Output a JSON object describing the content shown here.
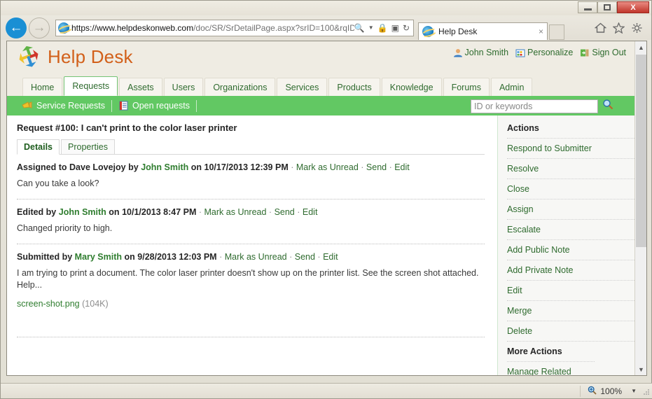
{
  "browser": {
    "window_controls": {
      "minimize": "minimize-icon",
      "restore": "restore-icon",
      "close": "X"
    },
    "nav": {
      "back": "back-icon",
      "forward": "forward-icon"
    },
    "address": {
      "protocol_host": "https://www.helpdeskonweb.com",
      "path": "/doc/SR/SrDetailPage.aspx?srID=100&rqID:",
      "full": "https://www.helpdeskonweb.com/doc/SR/SrDetailPage.aspx?srID=100&rqID:",
      "icons": [
        "search-icon",
        "chevron-down-icon",
        "lock-icon",
        "compatibility-view-icon",
        "refresh-icon"
      ]
    },
    "tab": {
      "title": "Help Desk",
      "close": "×"
    },
    "toolbar_icons": [
      "home-icon",
      "favorites-star-icon",
      "settings-gear-icon"
    ]
  },
  "site": {
    "title": "Help Desk",
    "logo": "pinwheel-arrows-logo",
    "account": {
      "user": "John Smith",
      "personalize": "Personalize",
      "sign_out": "Sign Out"
    },
    "tabs": [
      {
        "label": "Home",
        "active": false
      },
      {
        "label": "Requests",
        "active": true
      },
      {
        "label": "Assets",
        "active": false
      },
      {
        "label": "Users",
        "active": false
      },
      {
        "label": "Organizations",
        "active": false
      },
      {
        "label": "Services",
        "active": false
      },
      {
        "label": "Products",
        "active": false
      },
      {
        "label": "Knowledge",
        "active": false
      },
      {
        "label": "Forums",
        "active": false
      },
      {
        "label": "Admin",
        "active": false
      }
    ],
    "greenbar": {
      "items": [
        {
          "label": "Service Requests",
          "icon": "megaphone-icon"
        },
        {
          "label": "Open requests",
          "icon": "notepad-icon"
        }
      ],
      "search": {
        "value": "",
        "placeholder": "ID or keywords",
        "button": "search-icon"
      }
    }
  },
  "request": {
    "title": "Request #100: I can't print to the color laser printer",
    "subtabs": [
      {
        "label": "Details",
        "active": true
      },
      {
        "label": "Properties",
        "active": false
      }
    ],
    "entries": [
      {
        "action": "Assigned to",
        "target": "Dave Lovejoy",
        "by_word": "by",
        "author": "John Smith",
        "on_word": "on",
        "timestamp": "10/17/2013 12:39 PM",
        "links": [
          "Mark as Unread",
          "Send",
          "Edit"
        ],
        "body": "Can you take a look?",
        "attachment": null
      },
      {
        "action": "Edited by",
        "target": "",
        "by_word": "",
        "author": "John Smith",
        "on_word": "on",
        "timestamp": "10/1/2013 8:47 PM",
        "links": [
          "Mark as Unread",
          "Send",
          "Edit"
        ],
        "body": "Changed priority to high.",
        "attachment": null
      },
      {
        "action": "Submitted by",
        "target": "",
        "by_word": "",
        "author": "Mary Smith",
        "on_word": "on",
        "timestamp": "9/28/2013 12:03 PM",
        "links": [
          "Mark as Unread",
          "Send",
          "Edit"
        ],
        "body": "I am trying to print a document. The color laser printer doesn't show up on the printer list. See the screen shot attached. Help...",
        "attachment": {
          "name": "screen-shot.png",
          "size": "(104K)"
        }
      }
    ]
  },
  "actions_panel": {
    "heading": "Actions",
    "items": [
      "Respond to Submitter",
      "Resolve",
      "Close",
      "Assign",
      "Escalate",
      "Add Public Note",
      "Add Private Note",
      "Edit",
      "Merge",
      "Delete"
    ],
    "more_heading": "More Actions",
    "more_items": [
      "Manage Related Requests"
    ]
  },
  "statusbar": {
    "zoom": "100%",
    "zoom_icon": "zoom-magnifier-icon",
    "dropdown": "▼"
  },
  "colors": {
    "brand_green": "#62c863",
    "link_green": "#2f6b2f",
    "title_orange": "#d2601a",
    "chrome_beige": "#e8e5dc"
  }
}
